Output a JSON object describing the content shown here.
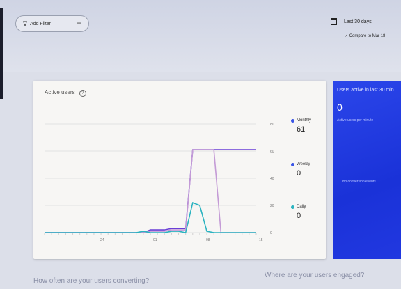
{
  "filter": {
    "add_filter_label": "Add Filter",
    "plus": "+"
  },
  "date": {
    "range_label": "Last 30 days",
    "compare_label": "Compare to Mar 18"
  },
  "active_users_card": {
    "title": "Active users",
    "legend": [
      {
        "label": "Monthly",
        "value": "61",
        "color": "#3b56e6"
      },
      {
        "label": "Weekly",
        "value": "0",
        "color": "#3b56e6"
      },
      {
        "label": "Daily",
        "value": "0",
        "color": "#2bb3c0"
      }
    ]
  },
  "realtime_card": {
    "title": "Users active in last 30 min",
    "value": "0",
    "sub_label": "Active users per minute",
    "events_label": "Top conversion events"
  },
  "bottom": {
    "conversion_question": "How often are your users converting?",
    "engagement_question": "Where are your users engaged?"
  },
  "chart_data": {
    "type": "line",
    "x": [
      0,
      1,
      2,
      3,
      4,
      5,
      6,
      7,
      8,
      9,
      10,
      11,
      12,
      13,
      14,
      15,
      16,
      17,
      18,
      19,
      20,
      21,
      22,
      23,
      24,
      25,
      26,
      27,
      28,
      29,
      30
    ],
    "x_tick_labels": [
      "",
      "24",
      "01",
      "08",
      "15"
    ],
    "y_tick_labels": [
      "0",
      "20",
      "40",
      "60",
      "80"
    ],
    "ylim": [
      0,
      80
    ],
    "series": [
      {
        "name": "Monthly",
        "color": "#6a3fd6",
        "values": [
          0,
          0,
          0,
          0,
          0,
          0,
          0,
          0,
          0,
          0,
          0,
          0,
          0,
          0,
          0,
          2,
          2,
          2,
          3,
          3,
          3,
          61,
          61,
          61,
          61,
          61,
          61,
          61,
          61,
          61,
          61
        ]
      },
      {
        "name": "Weekly",
        "color": "#c49bd6",
        "values": [
          0,
          0,
          0,
          0,
          0,
          0,
          0,
          0,
          0,
          0,
          0,
          0,
          0,
          0,
          0,
          1,
          1,
          1,
          2,
          2,
          2,
          61,
          61,
          61,
          61,
          0,
          0,
          0,
          0,
          0,
          0
        ]
      },
      {
        "name": "Daily",
        "color": "#2bb3c0",
        "values": [
          0,
          0,
          0,
          0,
          0,
          0,
          0,
          0,
          0,
          0,
          0,
          0,
          0,
          0,
          1,
          0,
          0,
          0,
          1,
          1,
          0,
          22,
          20,
          1,
          0,
          0,
          0,
          0,
          0,
          0,
          0
        ]
      }
    ],
    "grid": true
  }
}
